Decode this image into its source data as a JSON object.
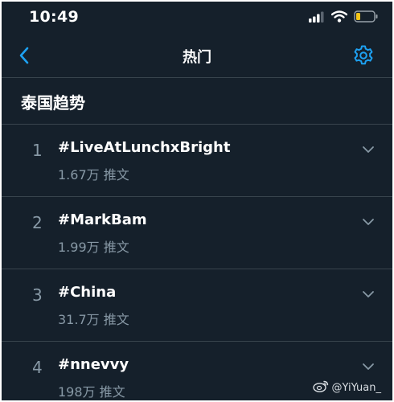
{
  "status_bar": {
    "time": "10:49",
    "icons": [
      "cellular-signal-icon",
      "wifi-icon",
      "battery-low-icon"
    ]
  },
  "nav": {
    "title": "热门",
    "back_icon": "chevron-left-icon",
    "settings_icon": "gear-icon"
  },
  "section": {
    "title": "泰国趋势"
  },
  "trends": [
    {
      "rank": "1",
      "name": "#LiveAtLunchxBright",
      "count": "1.67万 推文"
    },
    {
      "rank": "2",
      "name": "#MarkBam",
      "count": "1.99万 推文"
    },
    {
      "rank": "3",
      "name": "#China",
      "count": "31.7万 推文"
    },
    {
      "rank": "4",
      "name": "#nnevvy",
      "count": "198万 推文"
    }
  ],
  "watermark": {
    "text": "@YiYuan_",
    "icon": "weibo-logo-icon"
  },
  "colors": {
    "background": "#15202b",
    "divider": "#38444d",
    "accent": "#1da1f2",
    "secondary_text": "#8899a6",
    "battery": "#f5c518"
  }
}
